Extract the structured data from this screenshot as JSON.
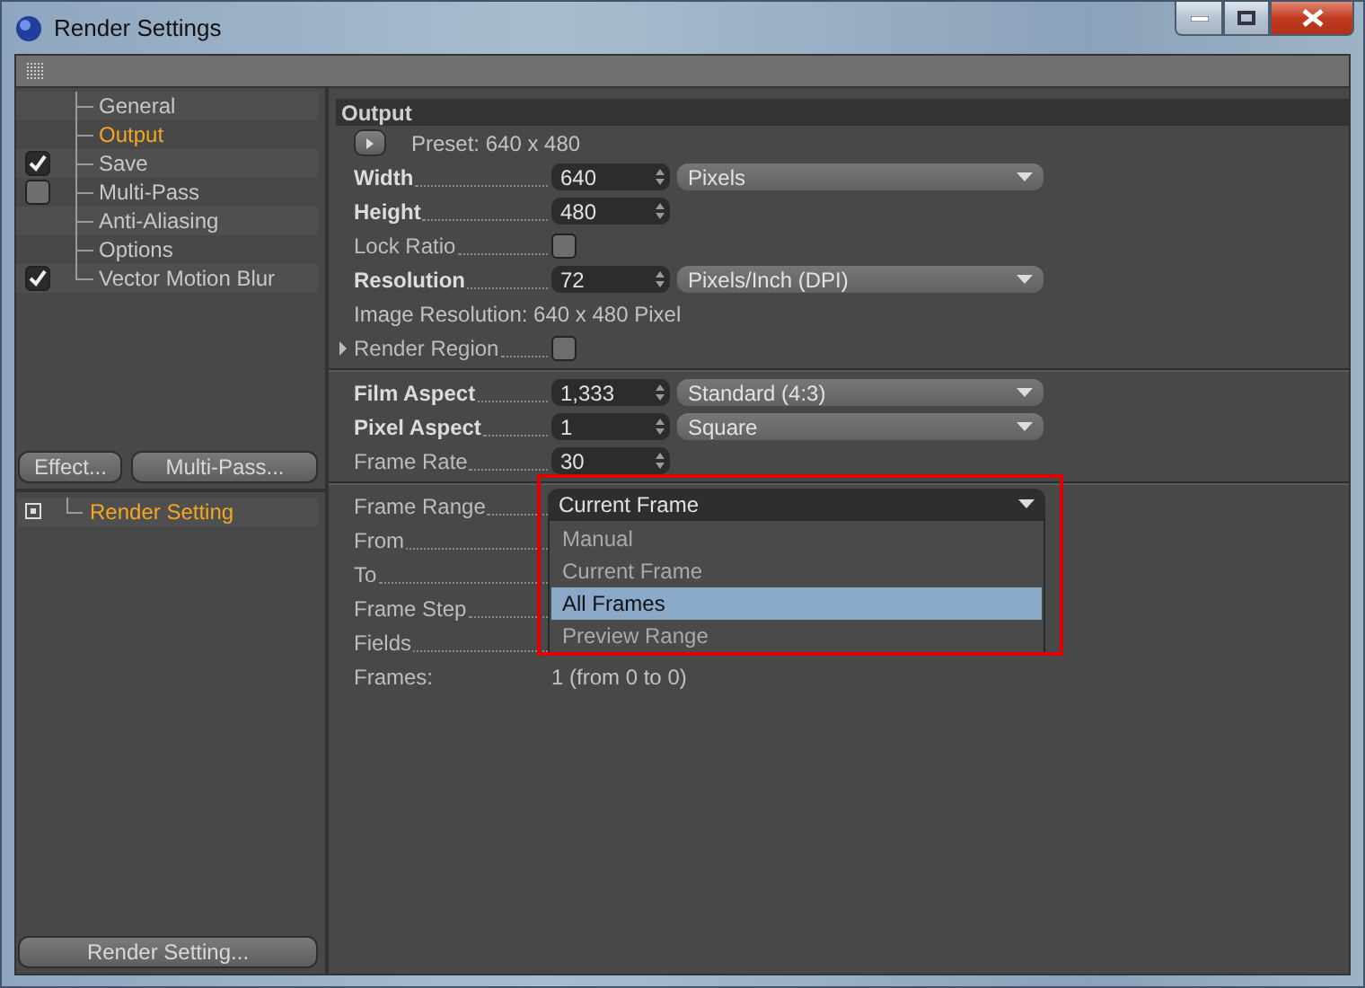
{
  "window": {
    "title": "Render Settings"
  },
  "sidebar": {
    "items": [
      {
        "label": "General",
        "selected": false,
        "kind": "plain"
      },
      {
        "label": "Output",
        "selected": true,
        "kind": "plain"
      },
      {
        "label": "Save",
        "selected": false,
        "kind": "toggle",
        "checked": true
      },
      {
        "label": "Multi-Pass",
        "selected": false,
        "kind": "toggle",
        "checked": false
      },
      {
        "label": "Anti-Aliasing",
        "selected": false,
        "kind": "plain"
      },
      {
        "label": "Options",
        "selected": false,
        "kind": "plain"
      },
      {
        "label": "Vector Motion Blur",
        "selected": false,
        "kind": "toggle",
        "checked": true
      }
    ],
    "buttons": [
      "Effect...",
      "Multi-Pass..."
    ],
    "settings": [
      {
        "label": "Render Setting",
        "selected": true
      }
    ],
    "bottom_button": "Render Setting..."
  },
  "output": {
    "title": "Output",
    "preset": "Preset: 640 x 480",
    "sections": [
      [
        {
          "kind": "spin",
          "label": "Width",
          "bold": true,
          "value": "640",
          "unit": "Pixels"
        },
        {
          "kind": "spin",
          "label": "Height",
          "bold": true,
          "value": "480"
        },
        {
          "kind": "check",
          "label": "Lock Ratio",
          "bold": false,
          "checked": false
        },
        {
          "kind": "spin",
          "label": "Resolution",
          "bold": true,
          "value": "72",
          "unit": "Pixels/Inch (DPI)"
        },
        {
          "kind": "info",
          "label": "Image Resolution: 640 x 480 Pixel"
        },
        {
          "kind": "region",
          "label": "Render Region",
          "bold": false,
          "checked": false
        }
      ],
      [
        {
          "kind": "spin",
          "label": "Film Aspect",
          "bold": true,
          "value": "1,333",
          "unit": "Standard (4:3)"
        },
        {
          "kind": "spin",
          "label": "Pixel Aspect",
          "bold": true,
          "value": "1",
          "unit": "Square"
        },
        {
          "kind": "spin",
          "label": "Frame Rate",
          "bold": false,
          "value": "30"
        }
      ],
      [
        {
          "kind": "menu",
          "label": "Frame Range",
          "bold": false,
          "value": "Current Frame",
          "options": [
            {
              "label": "Manual",
              "highlighted": false
            },
            {
              "label": "Current Frame",
              "highlighted": false
            },
            {
              "label": "All Frames",
              "highlighted": true
            },
            {
              "label": "Preview Range",
              "highlighted": false
            }
          ]
        },
        {
          "kind": "blank",
          "label": "From",
          "bold": false
        },
        {
          "kind": "blank",
          "label": "To",
          "bold": false
        },
        {
          "kind": "blank",
          "label": "Frame Step",
          "bold": false
        },
        {
          "kind": "blank",
          "label": "Fields",
          "bold": false
        },
        {
          "kind": "pair",
          "label": "Frames:",
          "value": "1 (from 0 to 0)"
        }
      ]
    ]
  }
}
